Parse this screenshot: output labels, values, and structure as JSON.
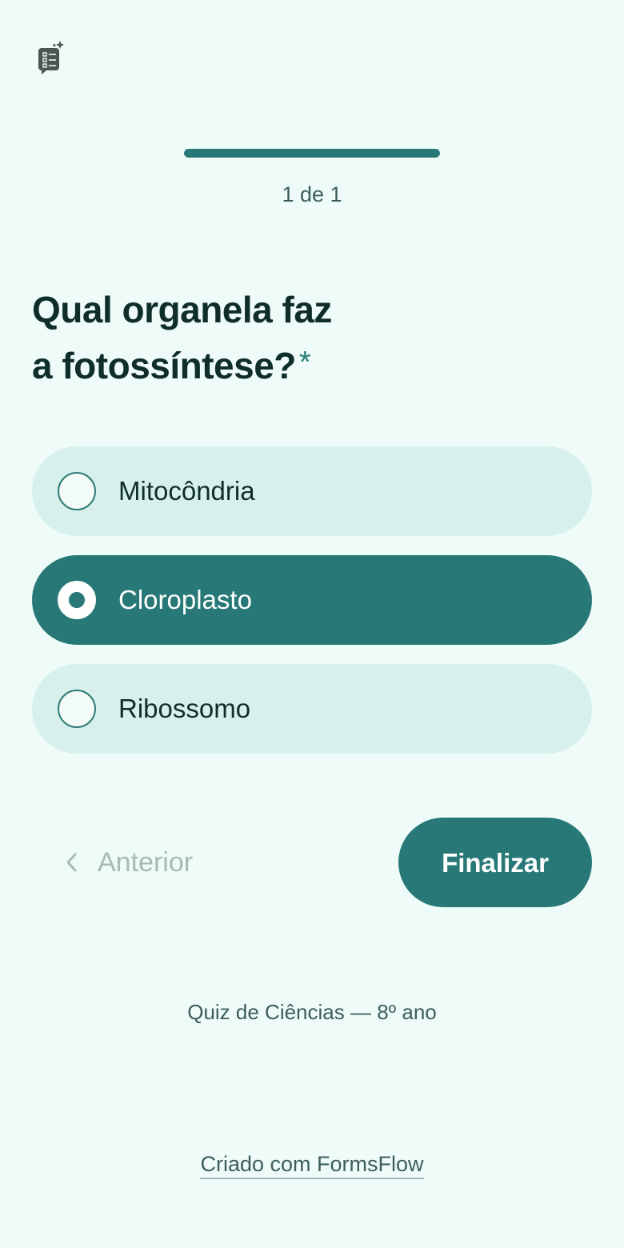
{
  "header": {
    "logo_icon": "form-sparkle-icon"
  },
  "progress": {
    "fraction": 1.0,
    "label": "1 de 1"
  },
  "question": {
    "title_line1": "Qual organela faz",
    "title_line2": "a fotossíntese?",
    "required_marker": "*"
  },
  "options": [
    {
      "label": "Mitocôndria",
      "selected": false
    },
    {
      "label": "Cloroplasto",
      "selected": true
    },
    {
      "label": "Ribossomo",
      "selected": false
    }
  ],
  "navigation": {
    "previous_label": "Anterior",
    "previous_icon": "chevron-left-icon",
    "finish_label": "Finalizar"
  },
  "footer": {
    "quiz_name": "Quiz de Ciências — 8º ano",
    "credit": "Criado com FormsFlow"
  },
  "colors": {
    "accent": "#277876",
    "background": "#eefbf8",
    "option_background": "#d7f0ec"
  }
}
